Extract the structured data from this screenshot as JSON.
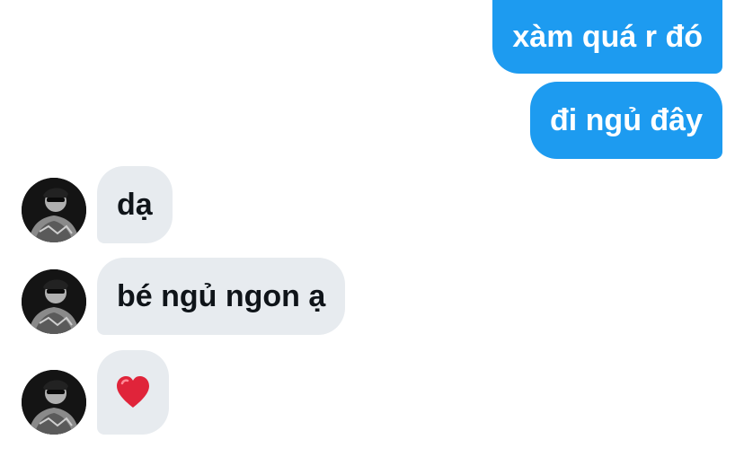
{
  "messages_out": [
    {
      "text": "xàm quá r đó"
    },
    {
      "text": "đi ngủ đây"
    }
  ],
  "messages_in": [
    {
      "text": "dạ"
    },
    {
      "text": "bé ngủ ngon ạ"
    },
    {
      "emoji": "heart-emoji"
    }
  ],
  "avatar_icon": "profile-photo",
  "colors": {
    "outgoing_bubble": "#1d9bf0",
    "incoming_bubble": "#e7ebef",
    "outgoing_text": "#ffffff",
    "incoming_text": "#0f1419",
    "heart": "#e0243a"
  }
}
